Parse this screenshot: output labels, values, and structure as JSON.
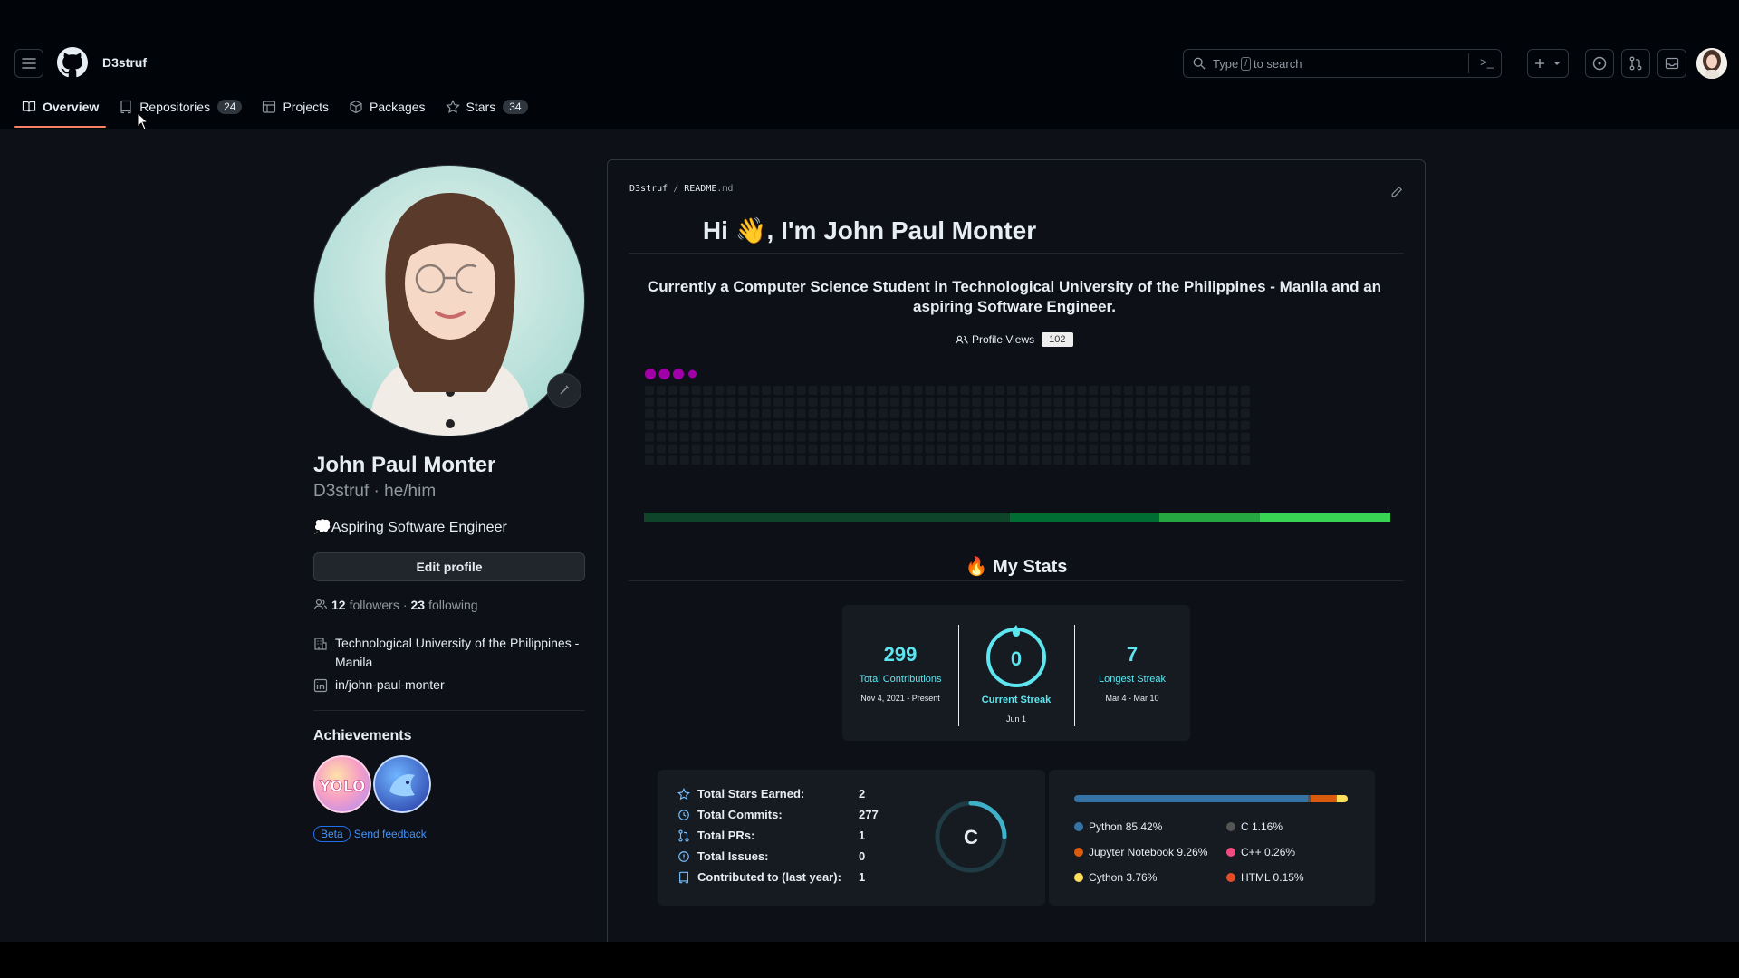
{
  "header": {
    "username": "D3struf",
    "search": {
      "prefix": "Type",
      "key": "/",
      "suffix": "to search",
      "command_icon": ">_"
    }
  },
  "tabs": [
    {
      "label": "Overview",
      "count": ""
    },
    {
      "label": "Repositories",
      "count": "24"
    },
    {
      "label": "Projects",
      "count": ""
    },
    {
      "label": "Packages",
      "count": ""
    },
    {
      "label": "Stars",
      "count": "34"
    }
  ],
  "profile": {
    "name": "John Paul Monter",
    "handle": "D3struf · he/him",
    "bio": "💭Aspiring Software Engineer",
    "edit_label": "Edit profile",
    "followers_count": "12",
    "followers_label": "followers",
    "dot": "·",
    "following_count": "23",
    "following_label": "following",
    "organization_line1": "Technological University of the Philippines -",
    "organization_line2": "Manila",
    "linkedin": "in/john-paul-monter",
    "achievements_title": "Achievements",
    "achievements": [
      {
        "name": "YOLO",
        "text": "YOLO"
      },
      {
        "name": "Pull Shark",
        "text": "Shark"
      }
    ],
    "beta_label": "Beta",
    "feedback_label": "Send feedback"
  },
  "readme": {
    "path_owner": "D3struf",
    "path_sep": "/",
    "path_file": "README",
    "path_ext": ".md",
    "title": "Hi 👋, I'm John Paul Monter",
    "paragraph": "Currently a Computer Science Student in Technological University of the Philippines - Manila and an aspiring Software Engineer.",
    "views_label": "Profile Views",
    "views_count": "102",
    "stats_title": "🔥 My Stats"
  },
  "streak": {
    "total": "299",
    "total_label": "Total Contributions",
    "total_range": "Nov 4, 2021 - Present",
    "current": "0",
    "current_label": "Current Streak",
    "current_date": "Jun 1",
    "longest": "7",
    "longest_label": "Longest Streak",
    "longest_range": "Mar 4 - Mar 10"
  },
  "github_stats": {
    "rows": [
      {
        "label": "Total Stars Earned:",
        "value": "2",
        "icon": "star-icon"
      },
      {
        "label": "Total Commits:",
        "value": "277",
        "icon": "history-icon"
      },
      {
        "label": "Total PRs:",
        "value": "1",
        "icon": "pull-request-icon"
      },
      {
        "label": "Total Issues:",
        "value": "0",
        "icon": "issue-icon"
      },
      {
        "label": "Contributed to (last year):",
        "value": "1",
        "icon": "repo-icon"
      }
    ],
    "rank": "C",
    "rank_progress": 0.25
  },
  "languages": [
    {
      "name": "Python 85.42%",
      "pct": 85.42,
      "color": "#3572A5"
    },
    {
      "name": "C 1.16%",
      "pct": 1.16,
      "color": "#555555"
    },
    {
      "name": "Jupyter Notebook 9.26%",
      "pct": 9.26,
      "color": "#DA5B0B"
    },
    {
      "name": "C++ 0.26%",
      "pct": 0.26,
      "color": "#f34b7d"
    },
    {
      "name": "Cython 3.76%",
      "pct": 3.76,
      "color": "#fedf5b"
    },
    {
      "name": "HTML 0.15%",
      "pct": 0.15,
      "color": "#e34c26"
    }
  ],
  "colors": {
    "accent_tab": "#f78166",
    "link": "#4493f8",
    "streak_cyan": "#5ee6f0",
    "snake_purple": "#a100a8"
  }
}
